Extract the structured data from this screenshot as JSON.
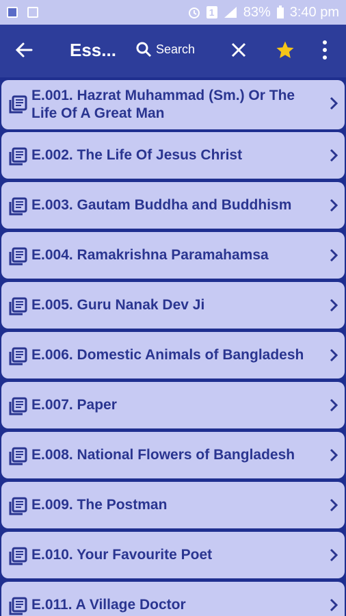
{
  "status_bar": {
    "battery": "83%",
    "time": "3:40 pm",
    "sim": "1"
  },
  "app_bar": {
    "title": "Ess...",
    "search_label": "Search"
  },
  "items": [
    {
      "label": "E.001. Hazrat Muhammad (Sm.) Or The Life Of A Great Man"
    },
    {
      "label": "E.002. The Life Of Jesus Christ"
    },
    {
      "label": "E.003. Gautam Buddha and Buddhism"
    },
    {
      "label": "E.004. Ramakrishna Paramahamsa"
    },
    {
      "label": "E.005. Guru Nanak Dev Ji"
    },
    {
      "label": "E.006. Domestic Animals of Bangladesh"
    },
    {
      "label": "E.007. Paper"
    },
    {
      "label": "E.008. National Flowers of Bangladesh"
    },
    {
      "label": "E.009. The Postman"
    },
    {
      "label": "E.010. Your Favourite Poet"
    },
    {
      "label": "E.011. A Village Doctor"
    }
  ],
  "colors": {
    "primary": "#2d3d9a",
    "background": "#1f2f8f",
    "item_bg": "#c7caf3",
    "item_text": "#2a3590",
    "star": "#f5c518"
  }
}
